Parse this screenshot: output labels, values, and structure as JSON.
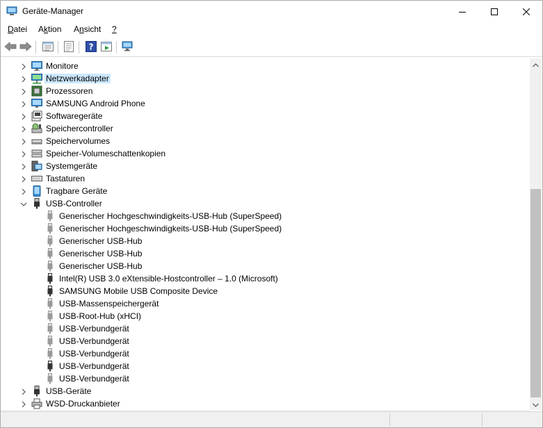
{
  "window": {
    "title": "Geräte-Manager"
  },
  "menu": [
    {
      "label": "Datei",
      "accel": "D",
      "rest": "atei"
    },
    {
      "label": "Aktion",
      "accel": "k",
      "pre": "A",
      "rest": "tion"
    },
    {
      "label": "Ansicht",
      "accel": "n",
      "pre": "A",
      "rest": "sicht"
    },
    {
      "label": "?"
    }
  ],
  "toolbar": [
    "back-arrow-icon",
    "forward-arrow-icon",
    "properties-icon",
    "driver-icon",
    "help-icon",
    "action-icon",
    "scan-hardware-icon"
  ],
  "tree": {
    "categories_top": [
      {
        "label": "Monitore",
        "icon": "monitor-icon"
      },
      {
        "label": "Netzwerkadapter",
        "icon": "network-adapter-icon",
        "selected": true
      },
      {
        "label": "Prozessoren",
        "icon": "processor-icon"
      },
      {
        "label": "SAMSUNG Android Phone",
        "icon": "phone-monitor-icon"
      },
      {
        "label": "Softwaregeräte",
        "icon": "software-device-icon"
      },
      {
        "label": "Speichercontroller",
        "icon": "storage-controller-icon"
      },
      {
        "label": "Speichervolumes",
        "icon": "drive-icon"
      },
      {
        "label": "Speicher-Volumeschattenkopien",
        "icon": "shadow-copy-icon"
      },
      {
        "label": "Systemgeräte",
        "icon": "system-device-icon"
      },
      {
        "label": "Tastaturen",
        "icon": "keyboard-icon"
      },
      {
        "label": "Tragbare Geräte",
        "icon": "portable-device-icon"
      }
    ],
    "usb_controller": {
      "label": "USB-Controller",
      "children": [
        "Generischer Hochgeschwindigkeits-USB-Hub (SuperSpeed)",
        "Generischer Hochgeschwindigkeits-USB-Hub (SuperSpeed)",
        "Generischer USB-Hub",
        "Generischer USB-Hub",
        "Generischer USB-Hub",
        "Intel(R) USB 3.0 eXtensible-Hostcontroller – 1.0 (Microsoft)",
        "SAMSUNG Mobile USB Composite Device",
        "USB-Massenspeichergerät",
        "USB-Root-Hub (xHCI)",
        "USB-Verbundgerät",
        "USB-Verbundgerät",
        "USB-Verbundgerät",
        "USB-Verbundgerät",
        "USB-Verbundgerät"
      ]
    },
    "categories_bottom": [
      {
        "label": "USB-Geräte",
        "icon": "usb-plug-icon"
      },
      {
        "label": "WSD-Druckanbieter",
        "icon": "printer-icon"
      }
    ]
  },
  "colors": {
    "selection": "#cce8ff",
    "accent": "#0078d7"
  }
}
